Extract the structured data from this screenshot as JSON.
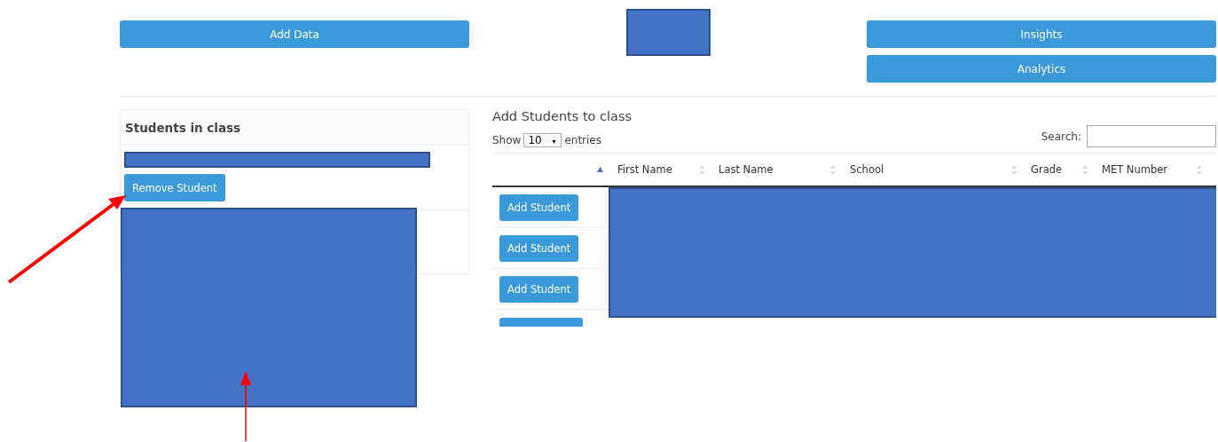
{
  "top_buttons": {
    "left": [
      "Add Data"
    ],
    "right": [
      "Insights",
      "Analytics"
    ]
  },
  "class_panel": {
    "title": "Students in class",
    "items": [
      {
        "button": "Remove Student",
        "redacted": true
      },
      {
        "redacted": true
      }
    ]
  },
  "add_panel": {
    "title": "Add Students to class",
    "show_label": "Show",
    "page_size": "10",
    "page_size_caret": "▾",
    "entries_label": "entries",
    "search_label": "Search:",
    "table": {
      "columns": [
        {
          "sorted": true
        },
        {
          "label": "First Name",
          "sorted": false
        },
        {
          "label": "Last Name",
          "sorted": false
        },
        {
          "label": "School",
          "sorted": false
        },
        {
          "label": "Grade",
          "sorted": false
        },
        {
          "label": "MET Number",
          "sorted": false
        }
      ],
      "rows": [
        {
          "button": "Add Student"
        },
        {
          "button": "Add Student"
        },
        {
          "button": "Add Student"
        }
      ],
      "partial_row": true,
      "redacted": true
    }
  },
  "header_redacted": true,
  "annotation_arrows": {
    "thick": true,
    "thin": true
  }
}
